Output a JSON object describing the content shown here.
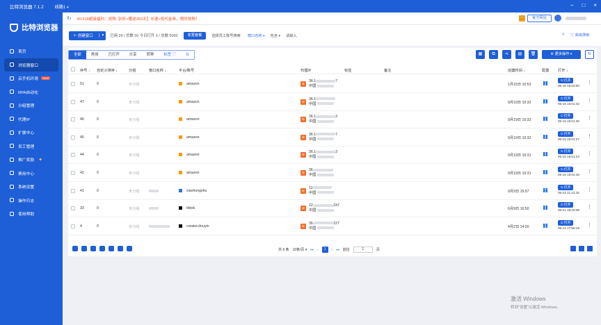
{
  "titlebar": {
    "app_title": "比特浏览器 7.1.2",
    "line": "线路1"
  },
  "sidebar": {
    "logo": "比特浏览器",
    "items": [
      {
        "label": "首页"
      },
      {
        "label": "浏览器窗口",
        "active": true
      },
      {
        "label": "云手机环境",
        "badge": "NEW"
      },
      {
        "label": "RPA自动化"
      },
      {
        "label": "分组管理"
      },
      {
        "label": "代理IP"
      },
      {
        "label": "扩展中心"
      },
      {
        "label": "员工管理"
      },
      {
        "label": "推广奖励"
      },
      {
        "label": "费用中心"
      },
      {
        "label": "系统设置"
      },
      {
        "label": "操作日志"
      },
      {
        "label": "使用帮助"
      }
    ]
  },
  "notice": {
    "message": "¥0.618超级福利：抢购【6折+赠送360天】光速+低代金券，限时抢购！",
    "site_button": "官方网站"
  },
  "toolbar": {
    "new_window": "创建窗口",
    "stats": "已用 29 / 总数 50   今日打开 0 / 总数 5000",
    "change_package": "变更套餐",
    "staff_filter": "选择员工账号搜索",
    "name_filter": "窗口名称",
    "contains": "包含",
    "placeholder": "请输入",
    "advanced": "高级搜索"
  },
  "tabs": [
    "全部",
    "常用",
    "已打开",
    "分享",
    "转移",
    "标签"
  ],
  "actions": {
    "more": "更多操作"
  },
  "columns": {
    "seq": "序号",
    "custom_sort": "自定义排序",
    "group": "分组",
    "window_name": "窗口名称",
    "platform": "平台/账号",
    "proxy": "代理IP",
    "tag": "标签",
    "remark": "备注",
    "created": "创建时间",
    "config": "配置",
    "open": "打开"
  },
  "rows": [
    {
      "seq": "51",
      "sort": "0",
      "group": "未分组",
      "platform": "amazon",
      "ip": "36.1",
      "ip_suffix": "7",
      "region": "中国",
      "created": "1月15日 10:53",
      "open_label": "打开",
      "last_open": "05-15 15:02:00"
    },
    {
      "seq": "47",
      "sort": "0",
      "group": "未分组",
      "platform": "amazon",
      "ip": "36.1",
      "ip_suffix": "",
      "region": "中国",
      "created": "9月19日 10:32",
      "open_label": "打开",
      "last_open": "05-15 15:01:42"
    },
    {
      "seq": "46",
      "sort": "0",
      "group": "未分组",
      "platform": "amazon",
      "ip": "36.1",
      "ip_suffix": "3",
      "region": "中国",
      "created": "9月19日 10:32",
      "open_label": "打开",
      "last_open": "05-15 15:01:30"
    },
    {
      "seq": "45",
      "sort": "0",
      "group": "未分组",
      "platform": "amazon",
      "ip": "36.1",
      "ip_suffix": "7",
      "region": "中国",
      "created": "9月19日 10:32",
      "open_label": "打开",
      "last_open": "05-15 15:01:27"
    },
    {
      "seq": "44",
      "sort": "0",
      "group": "未分组",
      "platform": "amazon",
      "ip": "36.1",
      "ip_suffix": "3",
      "region": "中国",
      "created": "9月19日 10:31",
      "open_label": "打开",
      "last_open": "05-15 15:01:22"
    },
    {
      "seq": "42",
      "sort": "0",
      "group": "未分组",
      "platform": "amazon",
      "ip": "36.",
      "ip_suffix": "",
      "region": "中国",
      "created": "9月19日 10:31",
      "open_label": "打开",
      "last_open": "05-15 15:01:18"
    },
    {
      "seq": "41",
      "sort": "0",
      "group": "未分组",
      "platform": "xiaohongshu",
      "ip": "11",
      "ip_suffix": "",
      "region": "中国",
      "created": "9月3日 15:57",
      "open_label": "打开",
      "last_open": "05-23 11:12:18"
    },
    {
      "seq": "33",
      "sort": "0",
      "group": "未分组",
      "platform": "tiktok",
      "ip": "22.",
      "ip_suffix": "247",
      "region": "中国",
      "created": "6月9日 16:50",
      "open_label": "打开",
      "last_open": "05-21 18:20:08"
    },
    {
      "seq": "4",
      "sort": "0",
      "group": "未分组",
      "platform": "creator.douyin",
      "ip": "36.",
      "ip_suffix": "227",
      "region": "中国",
      "created": "4月2日 14:20",
      "open_label": "打开",
      "last_open": "05-14 17:55:19"
    }
  ],
  "footer": {
    "total": "共 9 条",
    "per_page": "10条/页",
    "current_page": "1",
    "goto": "前往",
    "goto_value": "1",
    "page_unit": "页"
  },
  "watermark": {
    "line1": "激活 Windows",
    "line2": "转到\"设置\"以激活 Windows。"
  },
  "colors": {
    "brand": "#1e5fd7",
    "notice": "#e8542b",
    "proxy_tag": "#f36f2a"
  }
}
